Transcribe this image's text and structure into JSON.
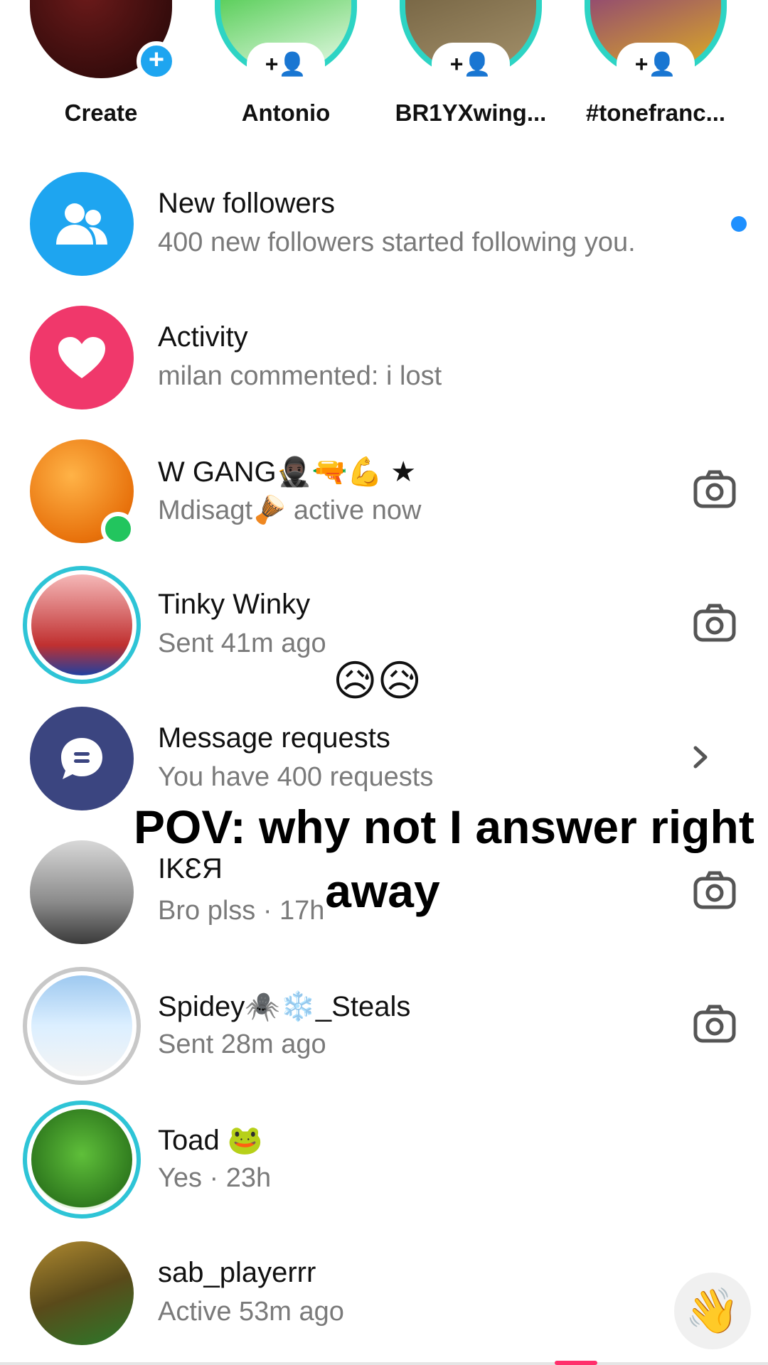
{
  "stories": [
    {
      "label": "Create",
      "badge": "+"
    },
    {
      "label": "Antonio",
      "follow_icon": "+👤"
    },
    {
      "label": "BR1YXwing...",
      "follow_icon": "+👤"
    },
    {
      "label": "#tonefranc...",
      "follow_icon": "+👤"
    }
  ],
  "rows": {
    "followers": {
      "title": "New followers",
      "sub": "400 new followers started following you.",
      "icon": "people-icon"
    },
    "activity": {
      "title": "Activity",
      "sub": "milan commented: i lost",
      "icon": "heart-icon"
    },
    "wgang": {
      "title": "W GANG🥷🏿🔫💪 ★",
      "sub": "Mdisagt🪘 active now",
      "icon": "camera-icon"
    },
    "tinky": {
      "title": "Tinky Winky",
      "sub": "Sent 41m ago",
      "icon": "camera-icon"
    },
    "requests": {
      "title": "Message requests",
      "sub": "You have 400 requests",
      "icon": "chevron-right-icon"
    },
    "ikea": {
      "title": "IKƐЯ",
      "sub": "Bro plss · 17h",
      "icon": "camera-icon"
    },
    "spidey": {
      "title": "Spidey🕷️❄️_Steals",
      "sub": "Sent 28m ago",
      "icon": "camera-icon"
    },
    "toad": {
      "title": "Toad 🐸",
      "sub": "Yes · 23h"
    },
    "sab": {
      "title": "sab_playerrr",
      "sub": "Active 53m ago",
      "icon": "wave-icon"
    }
  },
  "emojis": {
    "sad": "😥😥",
    "wave": "👋"
  },
  "overlay": {
    "line1": "POV: why not I answer right",
    "line2": "away"
  },
  "colors": {
    "accent_blue": "#1ea5f0",
    "heart_pink": "#f0386b",
    "requests_navy": "#3b4580",
    "story_ring": "#2dd4c4",
    "online_green": "#22c55e"
  }
}
